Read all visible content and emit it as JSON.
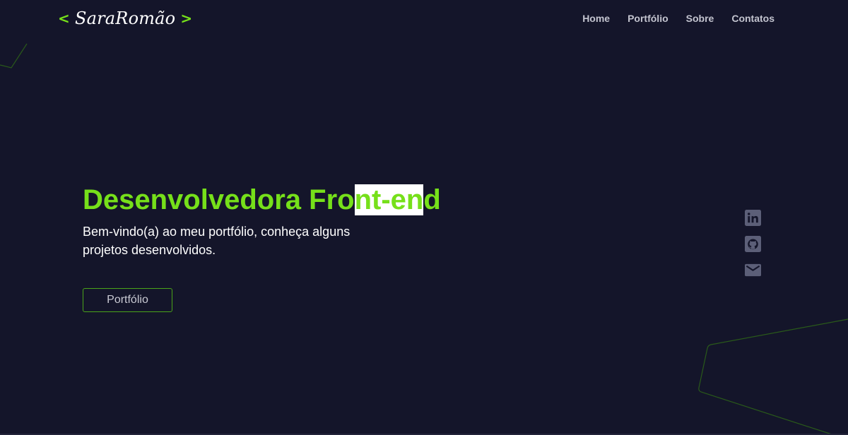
{
  "header": {
    "logo": {
      "left_bracket": "<",
      "name": "SaraRomão",
      "right_bracket": ">"
    },
    "nav": [
      {
        "label": "Home"
      },
      {
        "label": "Portfólio"
      },
      {
        "label": "Sobre"
      },
      {
        "label": "Contatos"
      }
    ]
  },
  "hero": {
    "title_part1": "Desenvolvedora Fro",
    "title_highlight": "nt-en",
    "title_part2": "d",
    "subtitle": "Bem-vindo(a) ao meu portfólio, conheça alguns projetos desenvolvidos.",
    "button_label": "Portfólio"
  },
  "social": {
    "icons": [
      "linkedin-icon",
      "github-icon",
      "email-icon"
    ]
  },
  "colors": {
    "background": "#14152a",
    "accent": "#76e01a",
    "icon": "#5c5f78"
  }
}
